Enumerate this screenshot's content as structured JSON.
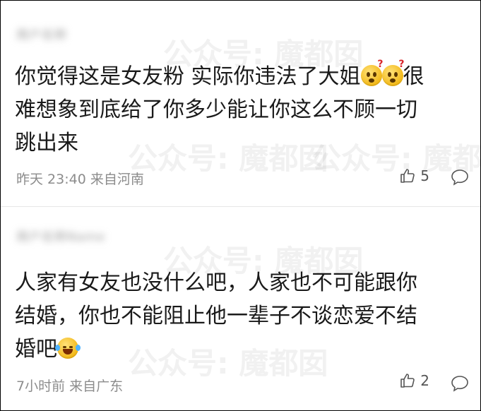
{
  "comments": [
    {
      "username": "用户名称",
      "content_text": "你觉得这是女友粉 实际你违法了大姐",
      "content_tail_line1": "很",
      "content_line2": "难想象到底给了你多少能让你这么不顾一切",
      "content_line3": "跳出来",
      "emojis": [
        "surprised-emoji",
        "surprised-emoji"
      ],
      "time": "昨天 23:40",
      "location": "来自河南",
      "likes": "5"
    },
    {
      "username": "用户名称Name",
      "content_line1": "人家有女友也没什么吧，人家也不可能跟你",
      "content_line2": "结婚，你也不能阻止他一辈子不谈恋爱不结",
      "content_line3": "婚吧",
      "emojis": [
        "laugh-cry-emoji"
      ],
      "time": "7小时前",
      "location": "来自广东",
      "likes": "2"
    }
  ],
  "watermark_text": "公众号: 魔都囡",
  "colors": {
    "text": "#1a1a1a",
    "meta": "#8c8c8c",
    "divider": "#e6e6e6"
  },
  "icons": [
    "thumbs-up-icon",
    "comment-icon"
  ]
}
